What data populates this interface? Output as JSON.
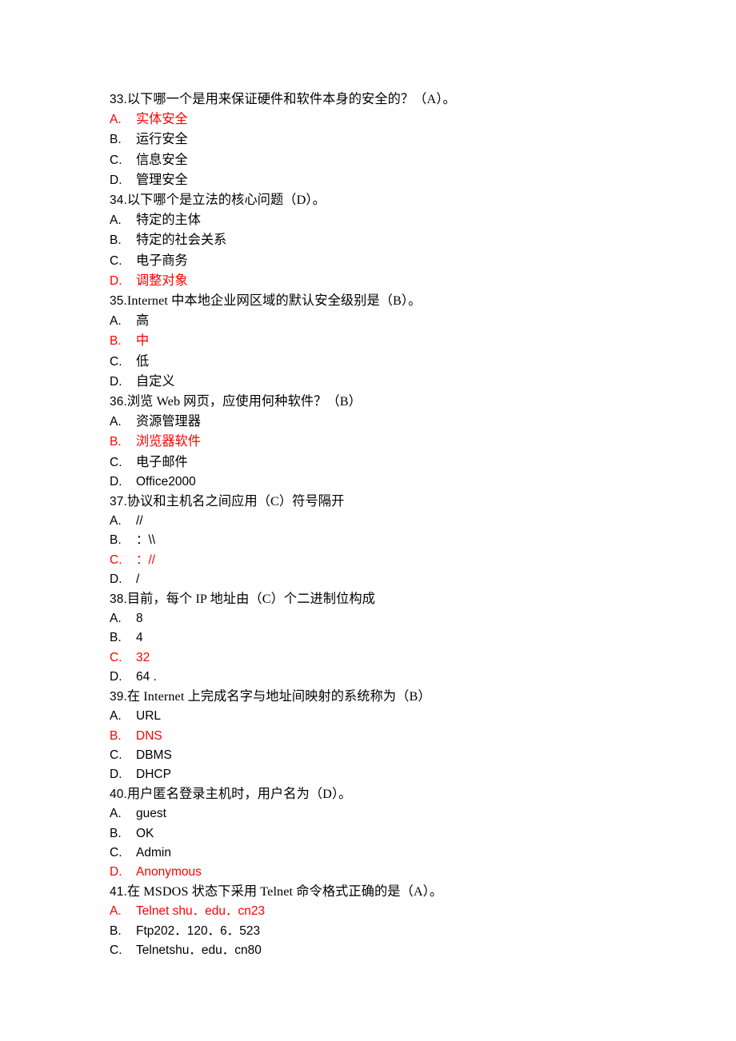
{
  "document": {
    "type": "multiple-choice-quiz",
    "answer_color": "#ff0000",
    "text_color": "#000000",
    "background": "#ffffff"
  },
  "questions": [
    {
      "number": "33.",
      "stem": "以下哪一个是用来保证硬件和软件本身的安全的？（A）。",
      "answer": "A",
      "options": [
        {
          "letter": "A.",
          "text": "实体安全",
          "cjk": true,
          "correct": true
        },
        {
          "letter": "B.",
          "text": "运行安全",
          "cjk": true,
          "correct": false
        },
        {
          "letter": "C.",
          "text": "信息安全",
          "cjk": true,
          "correct": false
        },
        {
          "letter": "D.",
          "text": "管理安全",
          "cjk": true,
          "correct": false
        }
      ]
    },
    {
      "number": "34.",
      "stem": "以下哪个是立法的核心问题（D）。",
      "answer": "D",
      "options": [
        {
          "letter": "A.",
          "text": "特定的主体",
          "cjk": true,
          "correct": false
        },
        {
          "letter": "B.",
          "text": "特定的社会关系",
          "cjk": true,
          "correct": false
        },
        {
          "letter": "C.",
          "text": "电子商务",
          "cjk": true,
          "correct": false
        },
        {
          "letter": "D.",
          "text": "调整对象",
          "cjk": true,
          "correct": true
        }
      ]
    },
    {
      "number": "35.",
      "stem": "Internet 中本地企业网区域的默认安全级别是（B）。",
      "answer": "B",
      "options": [
        {
          "letter": "A.",
          "text": "高",
          "cjk": true,
          "correct": false
        },
        {
          "letter": "B.",
          "text": "中",
          "cjk": true,
          "correct": true
        },
        {
          "letter": "C.",
          "text": "低",
          "cjk": true,
          "correct": false
        },
        {
          "letter": "D.",
          "text": "自定义",
          "cjk": true,
          "correct": false
        }
      ]
    },
    {
      "number": "36.",
      "stem": "浏览 Web 网页，应使用何种软件？（B）",
      "answer": "B",
      "options": [
        {
          "letter": "A.",
          "text": "资源管理器",
          "cjk": true,
          "correct": false
        },
        {
          "letter": "B.",
          "text": "浏览器软件",
          "cjk": true,
          "correct": true
        },
        {
          "letter": "C.",
          "text": "电子邮件",
          "cjk": true,
          "correct": false
        },
        {
          "letter": "D.",
          "text": "Office2000",
          "cjk": false,
          "correct": false
        }
      ]
    },
    {
      "number": "37.",
      "stem": "协议和主机名之间应用（C）符号隔开",
      "answer": "C",
      "options": [
        {
          "letter": "A.",
          "text": "//",
          "cjk": false,
          "correct": false
        },
        {
          "letter": "B.",
          "text": "：\\\\",
          "cjk": false,
          "correct": false
        },
        {
          "letter": "C.",
          "text": "：//",
          "cjk": false,
          "correct": true
        },
        {
          "letter": "D.",
          "text": "/",
          "cjk": false,
          "correct": false
        }
      ]
    },
    {
      "number": "38.",
      "stem": "目前，每个 IP 地址由（C）个二进制位构成",
      "answer": "C",
      "options": [
        {
          "letter": "A.",
          "text": "8",
          "cjk": false,
          "correct": false
        },
        {
          "letter": "B.",
          "text": "4",
          "cjk": false,
          "correct": false
        },
        {
          "letter": "C.",
          "text": "32",
          "cjk": false,
          "correct": true
        },
        {
          "letter": "D.",
          "text": "64 .",
          "cjk": false,
          "correct": false
        }
      ]
    },
    {
      "number": "39.",
      "stem": "在 Internet 上完成名字与地址间映射的系统称为（B）",
      "answer": "B",
      "options": [
        {
          "letter": "A.",
          "text": "URL",
          "cjk": false,
          "correct": false
        },
        {
          "letter": "B.",
          "text": "DNS",
          "cjk": false,
          "correct": true
        },
        {
          "letter": "C.",
          "text": "DBMS",
          "cjk": false,
          "correct": false
        },
        {
          "letter": "D.",
          "text": "DHCP",
          "cjk": false,
          "correct": false
        }
      ]
    },
    {
      "number": "40.",
      "stem": "用户匿名登录主机时，用户名为（D）。",
      "answer": "D",
      "options": [
        {
          "letter": "A.",
          "text": "guest",
          "cjk": false,
          "correct": false
        },
        {
          "letter": "B.",
          "text": "OK",
          "cjk": false,
          "correct": false
        },
        {
          "letter": "C.",
          "text": "Admin",
          "cjk": false,
          "correct": false
        },
        {
          "letter": "D.",
          "text": "Anonymous",
          "cjk": false,
          "correct": true
        }
      ]
    },
    {
      "number": "41.",
      "stem": "在 MSDOS 状态下采用 Telnet 命令格式正确的是（A）。",
      "answer": "A",
      "options": [
        {
          "letter": "A.",
          "text": "Telnet shu．edu．cn23",
          "cjk": false,
          "correct": true
        },
        {
          "letter": "B.",
          "text": "Ftp202．120．6．523",
          "cjk": false,
          "correct": false
        },
        {
          "letter": "C.",
          "text": "Telnetshu．edu．cn80",
          "cjk": false,
          "correct": false
        }
      ]
    }
  ]
}
